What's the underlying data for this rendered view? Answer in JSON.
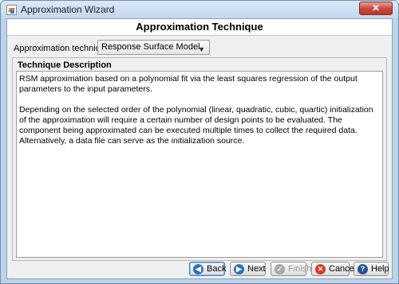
{
  "window": {
    "title": "Approximation Wizard",
    "close_label": "✕"
  },
  "header": {
    "title": "Approximation Technique"
  },
  "technique": {
    "label": "Approximation technique:",
    "selected": "Response Surface Model"
  },
  "description": {
    "title": "Technique Description",
    "paragraphs": [
      "RSM approximation based on a polynomial fit via the least squares regression of the output parameters to the input parameters.",
      "Depending on the selected order of the polynomial (linear, quadratic, cubic, quartic) initialization of the approximation will require a certain number of design points to be evaluated. The component being approximated can be executed multiple times to collect the required data. Alternatively, a data file can serve as the initialization source."
    ]
  },
  "buttons": {
    "back": "Back",
    "next": "Next",
    "finish": "Finish",
    "cancel": "Cancel",
    "help": "Help"
  },
  "icons": {
    "back": "left-arrow-icon",
    "next": "right-arrow-icon",
    "finish": "check-icon",
    "cancel": "cancel-icon",
    "help": "help-icon"
  },
  "colors": {
    "window_frame": "#bcd3ea",
    "close_button": "#c8453a",
    "default_button_border": "#3c7fb1"
  }
}
